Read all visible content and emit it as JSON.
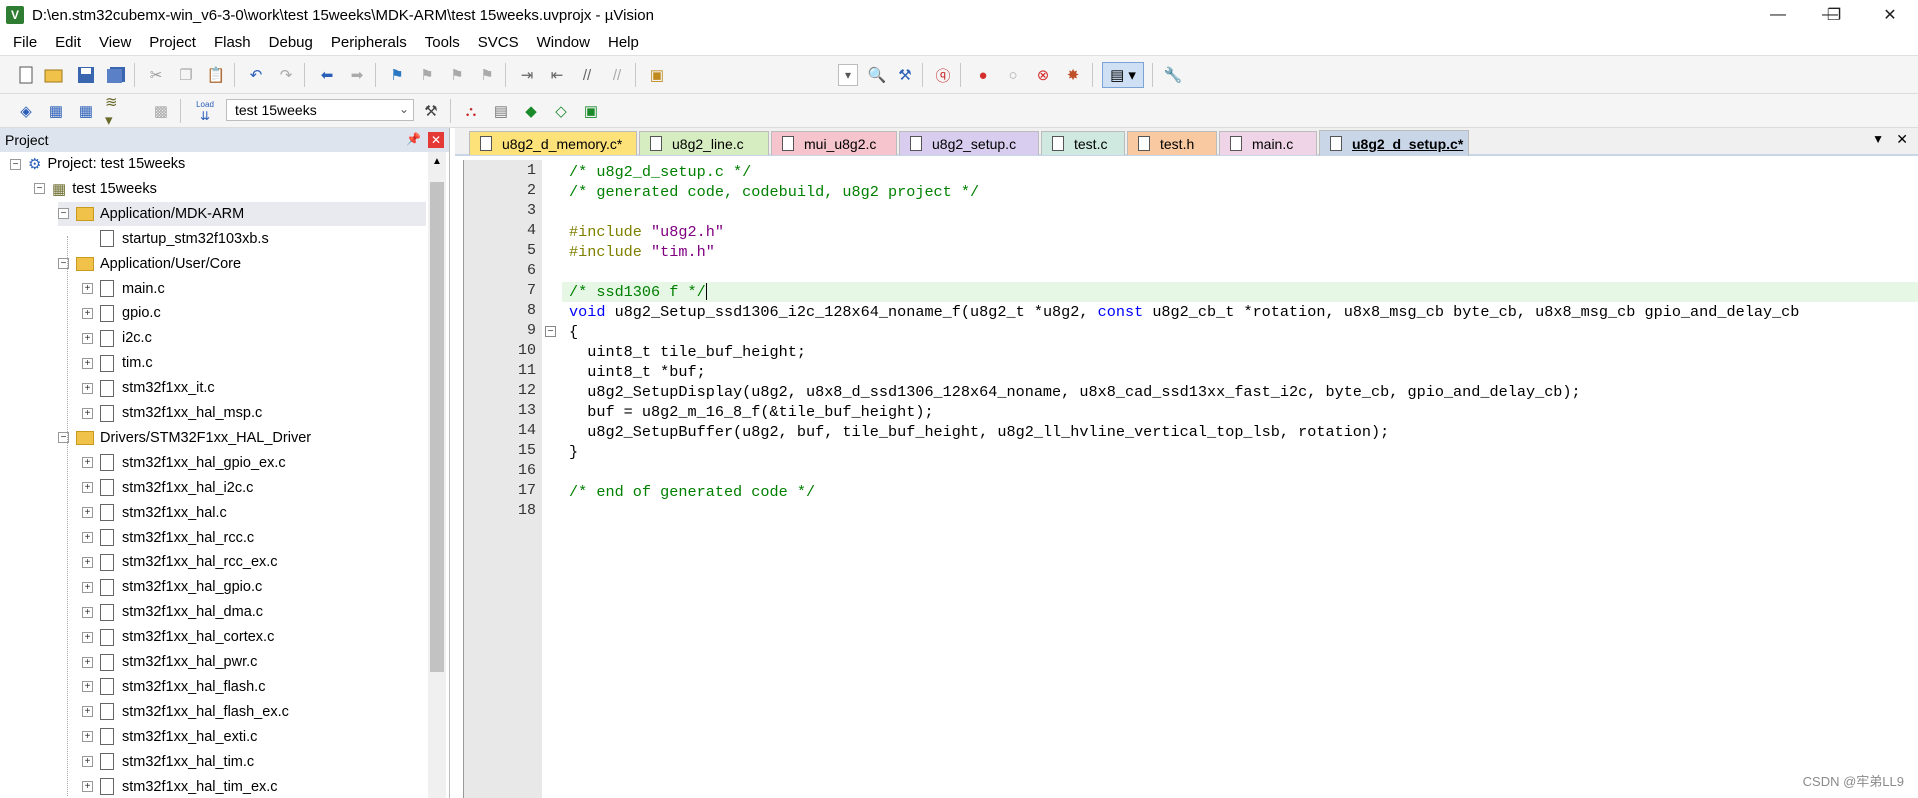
{
  "window": {
    "title": "D:\\en.stm32cubemx-win_v6-3-0\\work\\test 15weeks\\MDK-ARM\\test 15weeks.uvprojx - µVision",
    "app_icon": "V",
    "minimize": "—",
    "maximize": "❐",
    "close": "✕"
  },
  "menu": [
    "File",
    "Edit",
    "View",
    "Project",
    "Flash",
    "Debug",
    "Peripherals",
    "Tools",
    "SVCS",
    "Window",
    "Help"
  ],
  "toolbar2": {
    "target": "test 15weeks",
    "load_label": "Load"
  },
  "project_panel": {
    "title": "Project",
    "tree": [
      {
        "label": "Project: test 15weeks",
        "level": 0,
        "kind": "project",
        "expander": "−"
      },
      {
        "label": "test 15weeks",
        "level": 1,
        "kind": "target",
        "expander": "−"
      },
      {
        "label": "Application/MDK-ARM",
        "level": 2,
        "kind": "folder",
        "expander": "−",
        "selected": true
      },
      {
        "label": "startup_stm32f103xb.s",
        "level": 3,
        "kind": "file",
        "expander": ""
      },
      {
        "label": "Application/User/Core",
        "level": 2,
        "kind": "folder",
        "expander": "−"
      },
      {
        "label": "main.c",
        "level": 3,
        "kind": "file",
        "expander": "+"
      },
      {
        "label": "gpio.c",
        "level": 3,
        "kind": "file",
        "expander": "+"
      },
      {
        "label": "i2c.c",
        "level": 3,
        "kind": "file",
        "expander": "+"
      },
      {
        "label": "tim.c",
        "level": 3,
        "kind": "file",
        "expander": "+"
      },
      {
        "label": "stm32f1xx_it.c",
        "level": 3,
        "kind": "file",
        "expander": "+"
      },
      {
        "label": "stm32f1xx_hal_msp.c",
        "level": 3,
        "kind": "file",
        "expander": "+"
      },
      {
        "label": "Drivers/STM32F1xx_HAL_Driver",
        "level": 2,
        "kind": "folder",
        "expander": "−"
      },
      {
        "label": "stm32f1xx_hal_gpio_ex.c",
        "level": 3,
        "kind": "file",
        "expander": "+"
      },
      {
        "label": "stm32f1xx_hal_i2c.c",
        "level": 3,
        "kind": "file",
        "expander": "+"
      },
      {
        "label": "stm32f1xx_hal.c",
        "level": 3,
        "kind": "file",
        "expander": "+"
      },
      {
        "label": "stm32f1xx_hal_rcc.c",
        "level": 3,
        "kind": "file",
        "expander": "+"
      },
      {
        "label": "stm32f1xx_hal_rcc_ex.c",
        "level": 3,
        "kind": "file",
        "expander": "+"
      },
      {
        "label": "stm32f1xx_hal_gpio.c",
        "level": 3,
        "kind": "file",
        "expander": "+"
      },
      {
        "label": "stm32f1xx_hal_dma.c",
        "level": 3,
        "kind": "file",
        "expander": "+"
      },
      {
        "label": "stm32f1xx_hal_cortex.c",
        "level": 3,
        "kind": "file",
        "expander": "+"
      },
      {
        "label": "stm32f1xx_hal_pwr.c",
        "level": 3,
        "kind": "file",
        "expander": "+"
      },
      {
        "label": "stm32f1xx_hal_flash.c",
        "level": 3,
        "kind": "file",
        "expander": "+"
      },
      {
        "label": "stm32f1xx_hal_flash_ex.c",
        "level": 3,
        "kind": "file",
        "expander": "+"
      },
      {
        "label": "stm32f1xx_hal_exti.c",
        "level": 3,
        "kind": "file",
        "expander": "+"
      },
      {
        "label": "stm32f1xx_hal_tim.c",
        "level": 3,
        "kind": "file",
        "expander": "+"
      },
      {
        "label": "stm32f1xx_hal_tim_ex.c",
        "level": 3,
        "kind": "file",
        "expander": "+"
      }
    ]
  },
  "tabs": [
    {
      "label": "u8g2_d_memory.c*",
      "color": "#fde27a",
      "active": false
    },
    {
      "label": "u8g2_line.c",
      "color": "#d6ecc1",
      "active": false
    },
    {
      "label": "mui_u8g2.c",
      "color": "#f6c4cc",
      "active": false
    },
    {
      "label": "u8g2_setup.c",
      "color": "#d9cdef",
      "active": false
    },
    {
      "label": "test.c",
      "color": "#cfe9e0",
      "active": false
    },
    {
      "label": "test.h",
      "color": "#f9c9a2",
      "active": false
    },
    {
      "label": "main.c",
      "color": "#eed4e6",
      "active": false
    },
    {
      "label": "u8g2_d_setup.c*",
      "color": "#c9d6e8",
      "active": true
    }
  ],
  "editor": {
    "current_line": 7,
    "fold_lines": {
      "9": "−"
    },
    "lines": [
      "/* u8g2_d_setup.c */",
      "/* generated code, codebuild, u8g2 project */",
      "",
      "#include \"u8g2.h\"",
      "#include \"tim.h\"",
      "",
      "/* ssd1306 f */",
      "void u8g2_Setup_ssd1306_i2c_128x64_noname_f(u8g2_t *u8g2, const u8g2_cb_t *rotation, u8x8_msg_cb byte_cb, u8x8_msg_cb gpio_and_delay_cb",
      "{",
      "  uint8_t tile_buf_height;",
      "  uint8_t *buf;",
      "  u8g2_SetupDisplay(u8g2, u8x8_d_ssd1306_128x64_noname, u8x8_cad_ssd13xx_fast_i2c, byte_cb, gpio_and_delay_cb);",
      "  buf = u8g2_m_16_8_f(&tile_buf_height);",
      "  u8g2_SetupBuffer(u8g2, buf, tile_buf_height, u8g2_ll_hvline_vertical_top_lsb, rotation);",
      "}",
      "",
      "/* end of generated code */",
      ""
    ]
  },
  "watermark": "CSDN @牢弟LL9"
}
